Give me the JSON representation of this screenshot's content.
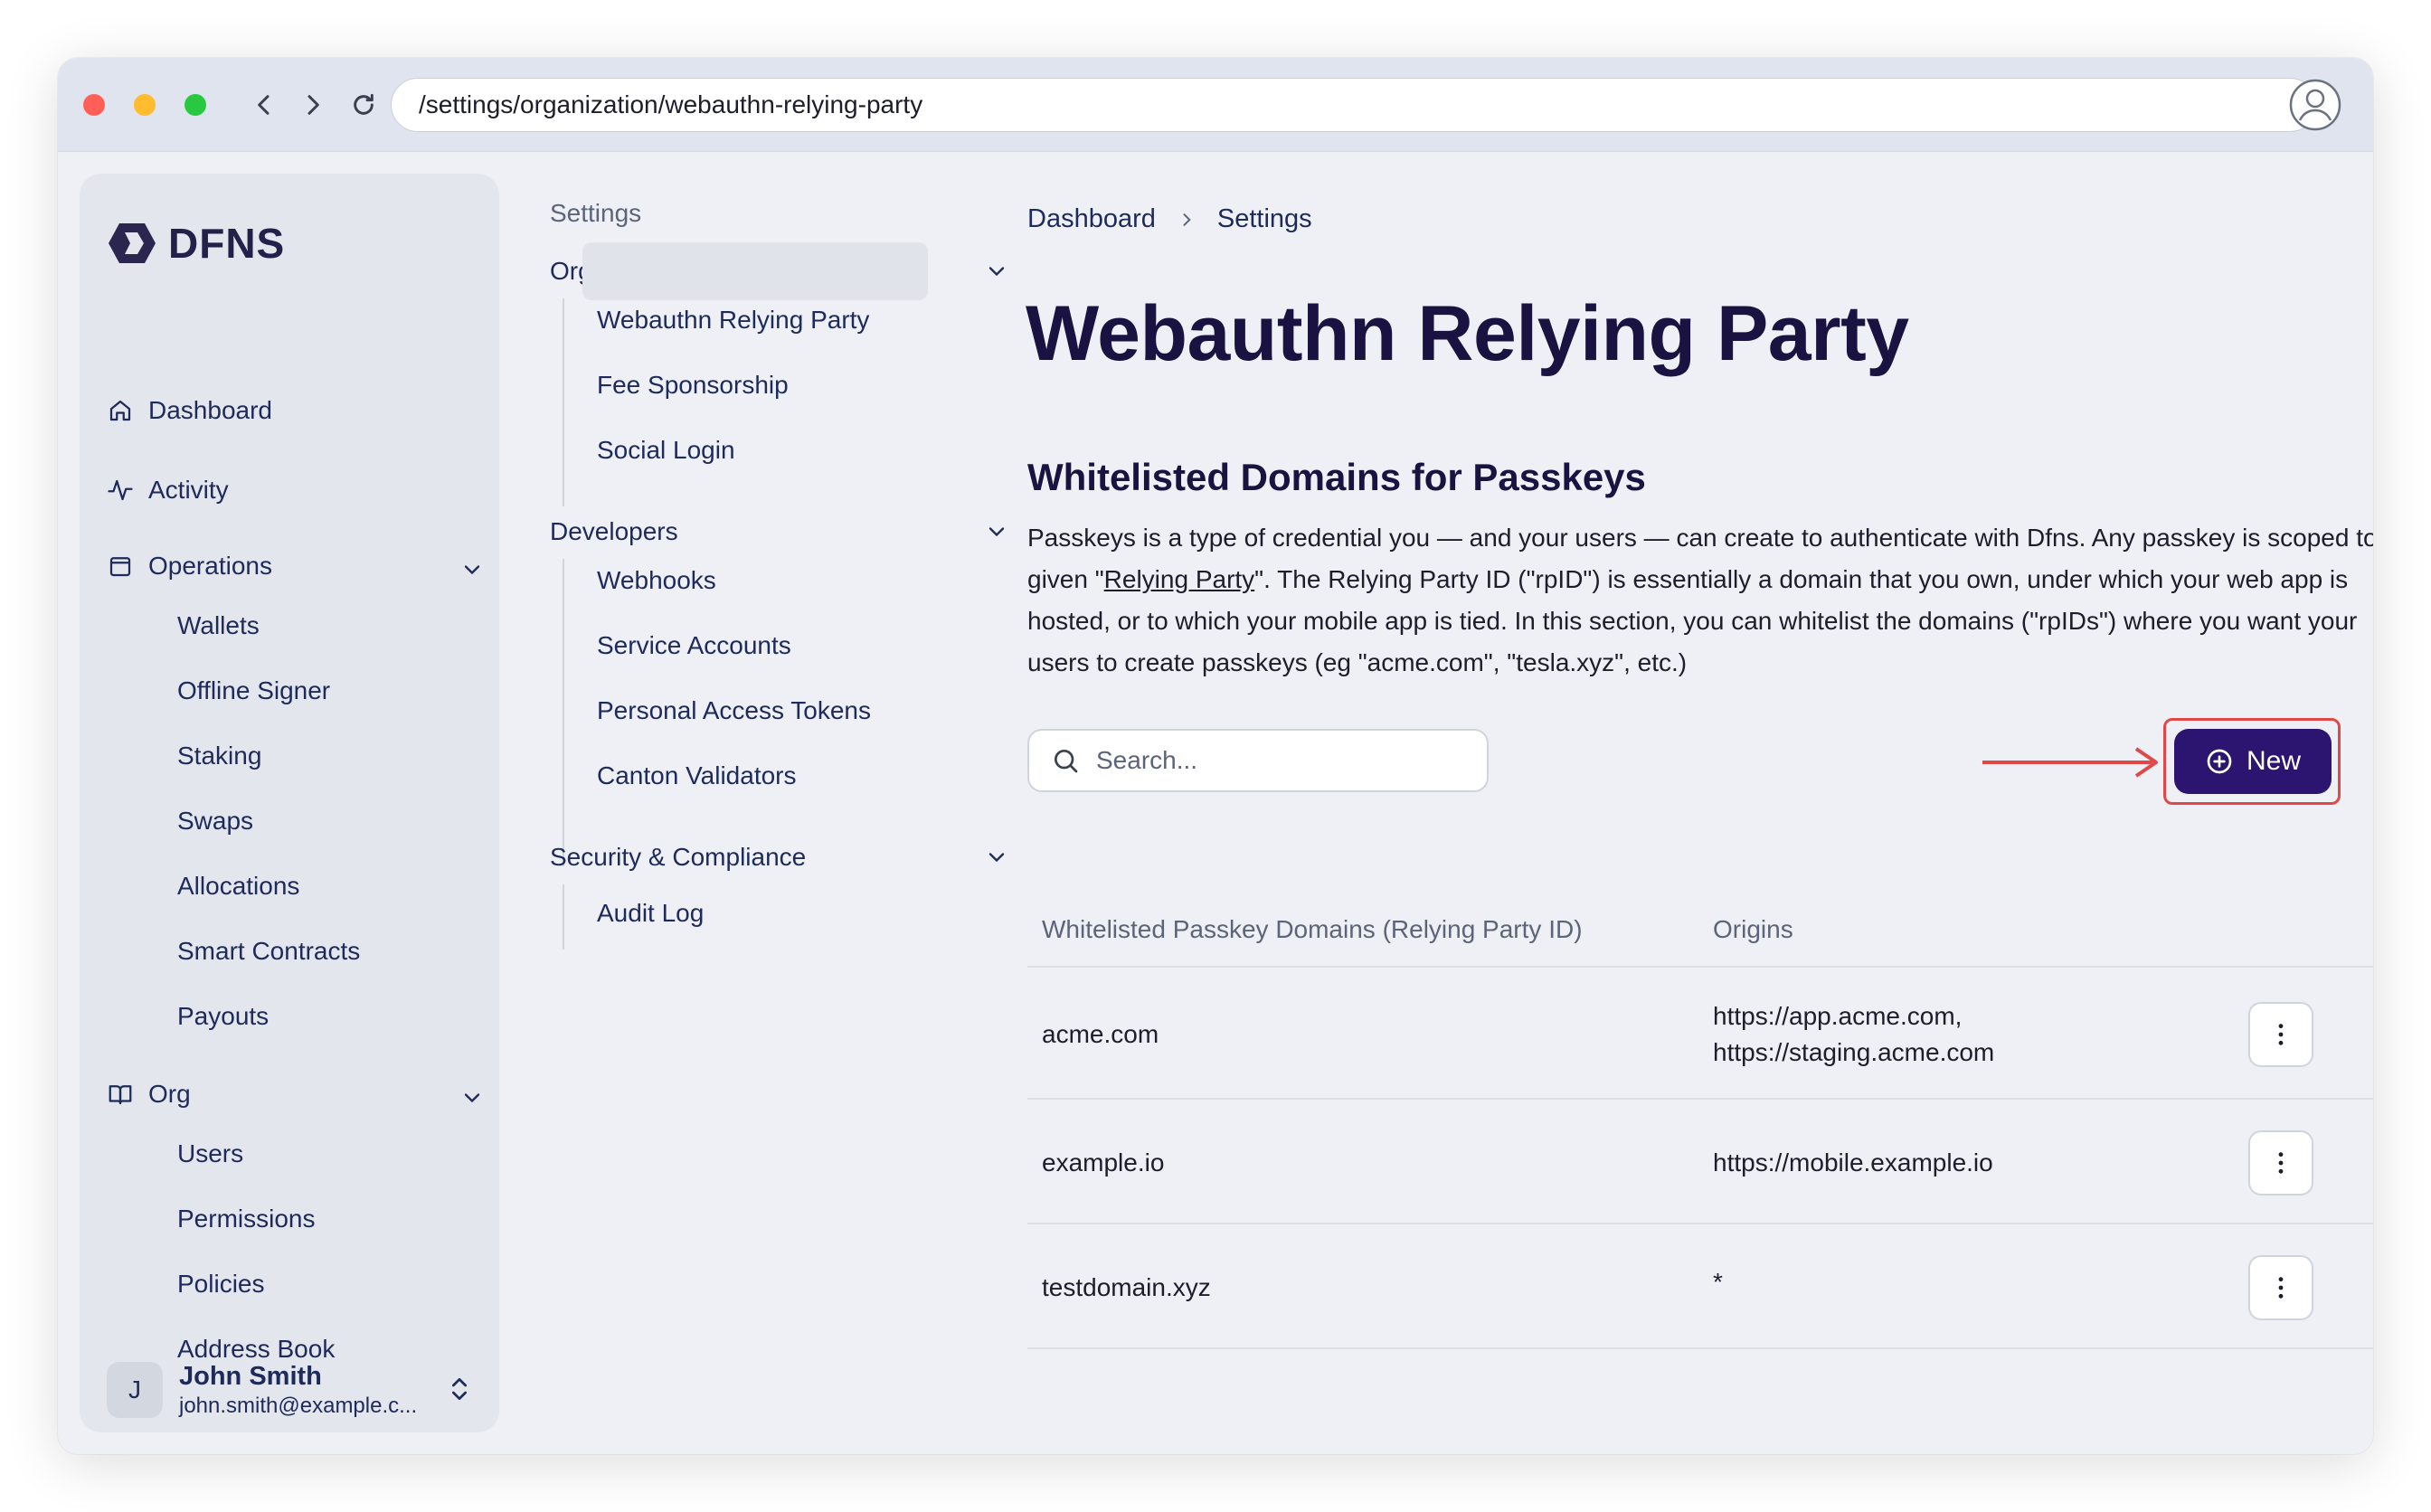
{
  "browser": {
    "url": "/settings/organization/webauthn-relying-party"
  },
  "sidebar": {
    "logo": "DFNS",
    "top_items": [
      {
        "label": "Dashboard",
        "icon": "home-icon"
      },
      {
        "label": "Activity",
        "icon": "activity-icon"
      }
    ],
    "operations": {
      "label": "Operations",
      "items": [
        "Wallets",
        "Offline Signer",
        "Staking",
        "Swaps",
        "Allocations",
        "Smart Contracts",
        "Payouts"
      ]
    },
    "org": {
      "label": "Org",
      "items": [
        "Users",
        "Permissions",
        "Policies",
        "Address Book"
      ]
    },
    "user": {
      "initial": "J",
      "name": "John Smith",
      "email": "john.smith@example.c..."
    }
  },
  "settings_nav": {
    "title": "Settings",
    "organization": {
      "label": "Organization",
      "items": [
        "Webauthn Relying Party",
        "Fee Sponsorship",
        "Social Login"
      ]
    },
    "developers": {
      "label": "Developers",
      "items": [
        "Webhooks",
        "Service Accounts",
        "Personal Access Tokens",
        "Canton Validators"
      ]
    },
    "security": {
      "label": "Security & Compliance",
      "items": [
        "Audit Log"
      ]
    }
  },
  "main": {
    "breadcrumb": [
      "Dashboard",
      "Settings"
    ],
    "title": "Webauthn Relying Party",
    "section_title": "Whitelisted Domains for Passkeys",
    "description": {
      "part1": "Passkeys is a type of credential you — and your users — can create to authenticate with Dfns. Any passkey is scoped to a given \"",
      "link": "Relying Party",
      "part2": "\". The Relying Party ID (\"rpID\") is essentially a domain that you own, under which your web app is hosted, or to which your mobile app is tied. In this section, you can whitelist the domains (\"rpIDs\") where you want your users to create passkeys (eg \"acme.com\", \"tesla.xyz\", etc.)"
    },
    "search_placeholder": "Search...",
    "new_button": "New",
    "table": {
      "headers": [
        "Whitelisted Passkey Domains (Relying Party ID)",
        "Origins"
      ],
      "rows": [
        {
          "domain": "acme.com",
          "origins": [
            "https://app.acme.com,",
            "https://staging.acme.com"
          ]
        },
        {
          "domain": "example.io",
          "origins": [
            "https://mobile.example.io"
          ]
        },
        {
          "domain": "testdomain.xyz",
          "origins": [
            "*"
          ]
        }
      ]
    }
  },
  "colors": {
    "accent": "#2b1570",
    "annotation": "#e04848",
    "text": "#1e2a5a"
  }
}
